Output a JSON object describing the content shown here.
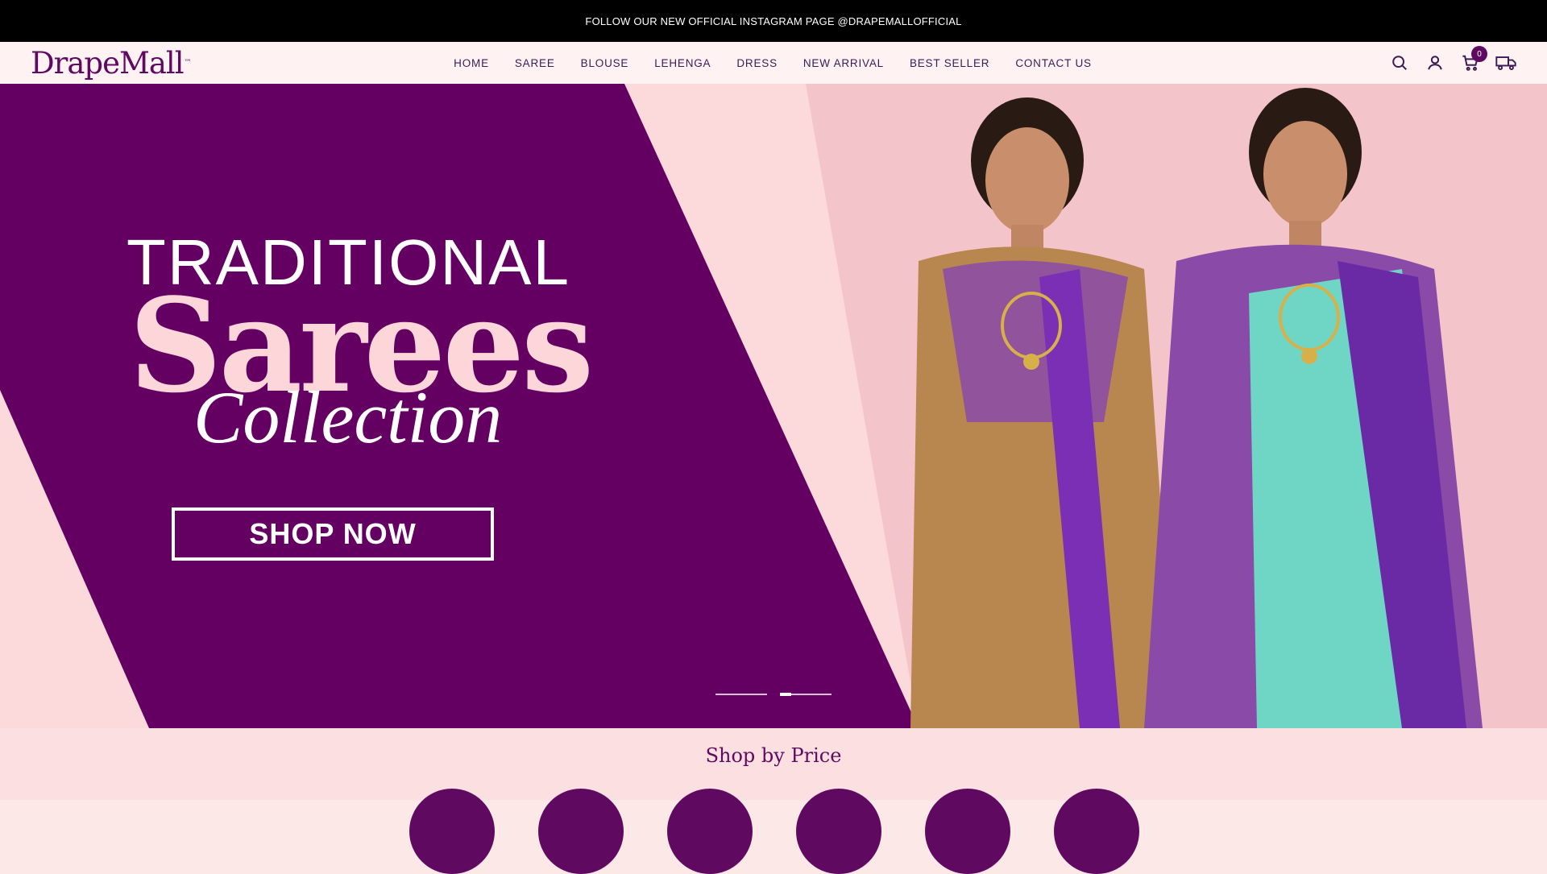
{
  "announcement": "FOLLOW OUR NEW OFFICIAL INSTAGRAM PAGE @DRAPEMALLOFFICIAL",
  "brand": {
    "name": "DrapeMall",
    "mark": "™"
  },
  "nav": [
    "HOME",
    "SAREE",
    "BLOUSE",
    "LEHENGA",
    "DRESS",
    "NEW ARRIVAL",
    "BEST SELLER",
    "CONTACT US"
  ],
  "header_icons": {
    "search": "search-icon",
    "account": "user-icon",
    "cart": "cart-icon",
    "cart_count": "0",
    "tracking": "truck-icon"
  },
  "hero": {
    "line1": "TRADITIONAL",
    "line2": "Sarees",
    "line3": "Collection",
    "cta": "SHOP NOW",
    "slides": 2,
    "active_slide": 2
  },
  "section": {
    "title": "Shop by Price"
  },
  "colors": {
    "brand_purple": "#5f0a60",
    "hero_pink": "#fcd9db",
    "topbar": "#000000"
  }
}
